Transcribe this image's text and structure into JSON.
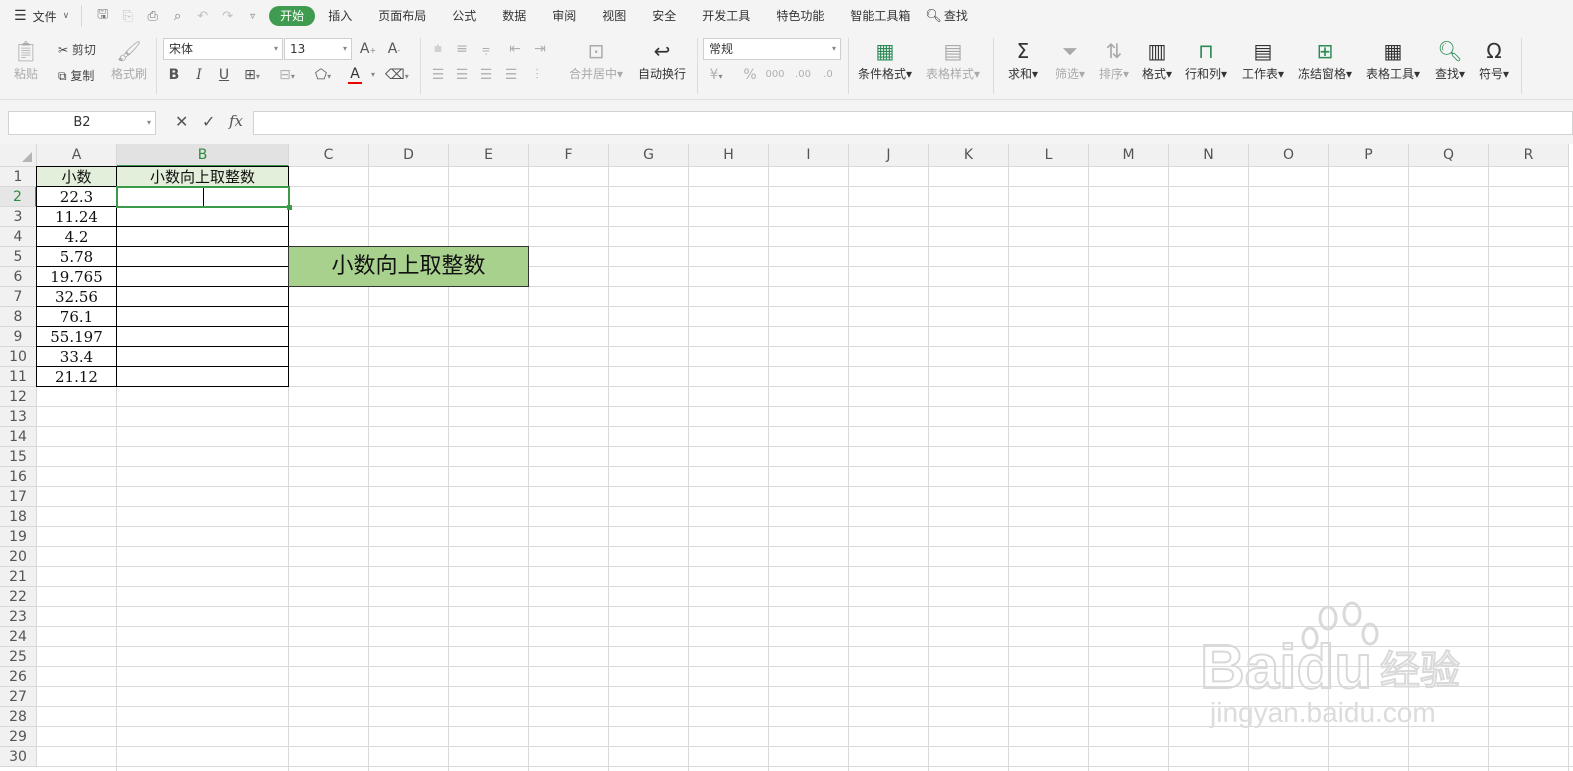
{
  "menu": {
    "file_label": "文件",
    "tabs": [
      "开始",
      "插入",
      "页面布局",
      "公式",
      "数据",
      "审阅",
      "视图",
      "安全",
      "开发工具",
      "特色功能",
      "智能工具箱"
    ],
    "active_tab": "开始",
    "search_label": "查找"
  },
  "ribbon": {
    "paste": "粘贴",
    "cut": "剪切",
    "copy": "复制",
    "format_painter": "格式刷",
    "font_name": "宋体",
    "font_size": "13",
    "merge_center": "合并居中",
    "wrap_text": "自动换行",
    "number_format": "常规",
    "conditional_format": "条件格式",
    "table_style": "表格样式",
    "sum": "求和",
    "filter": "筛选",
    "sort": "排序",
    "format": "格式",
    "rows_cols": "行和列",
    "worksheet": "工作表",
    "freeze": "冻结窗格",
    "table_tools": "表格工具",
    "find": "查找",
    "symbol": "符号"
  },
  "formula_bar": {
    "name_box": "B2",
    "fx": "fx",
    "content": ""
  },
  "sheet": {
    "columns": [
      "A",
      "B",
      "C",
      "D",
      "E",
      "F",
      "G",
      "H",
      "I",
      "J",
      "K",
      "L",
      "M",
      "N",
      "O",
      "P",
      "Q",
      "R"
    ],
    "rows": [
      "1",
      "2",
      "3",
      "4",
      "5",
      "6",
      "7",
      "8",
      "9",
      "10",
      "11",
      "12",
      "13",
      "14",
      "15",
      "16",
      "17",
      "18",
      "19",
      "20",
      "21",
      "22",
      "23",
      "24",
      "25",
      "26",
      "27",
      "28",
      "29",
      "30"
    ],
    "selected_column": "B",
    "selected_row": "2",
    "header_a": "小数",
    "header_b": "小数向上取整数",
    "values_a": [
      "22.3",
      "11.24",
      "4.2",
      "5.78",
      "19.765",
      "32.56",
      "76.1",
      "55.197",
      "33.4",
      "21.12"
    ],
    "note_box": "小数向上取整数"
  },
  "watermark": {
    "brand": "Baidu",
    "cn": "经验",
    "url": "jingyan.baidu.com"
  }
}
